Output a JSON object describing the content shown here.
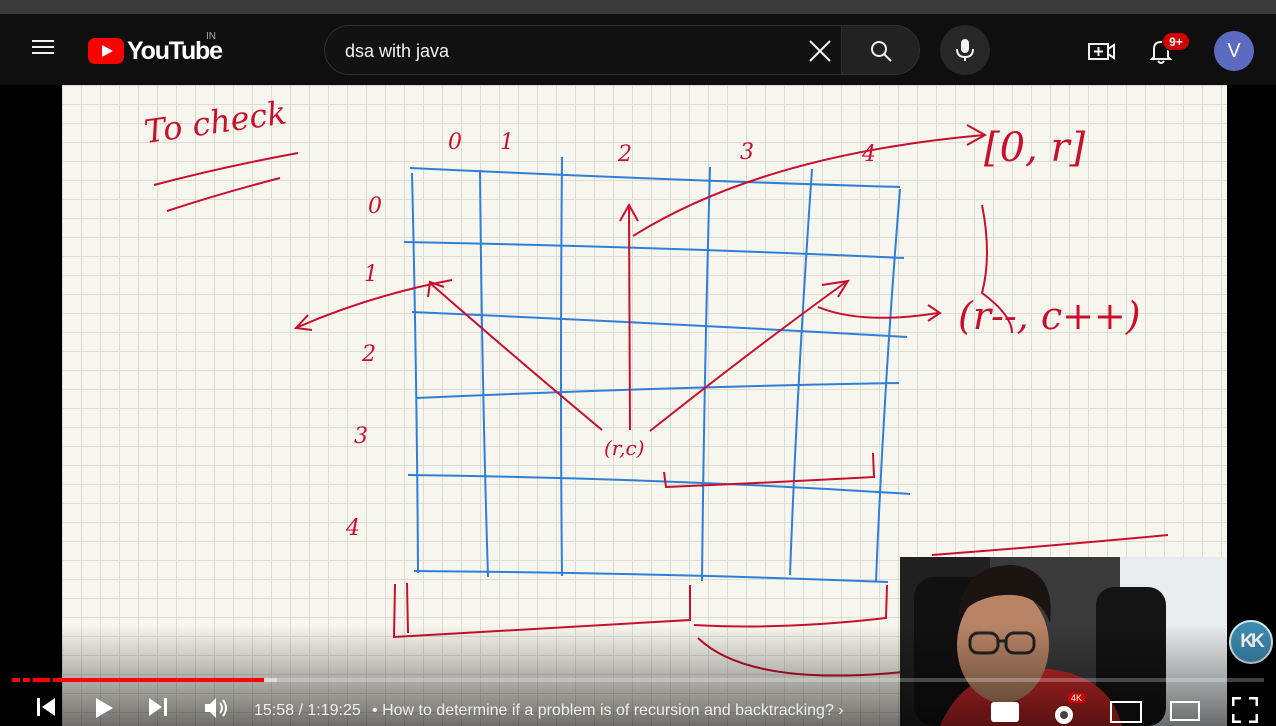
{
  "masthead": {
    "logo_text": "YouTube",
    "country_code": "IN",
    "search_value": "dsa with java",
    "notification_count": "9+",
    "avatar_letter": "V",
    "icons": [
      "menu-icon",
      "youtube-logo",
      "clear-icon",
      "search-icon",
      "mic-icon",
      "create-icon",
      "bell-icon"
    ]
  },
  "whiteboard": {
    "heading": "To check",
    "column_labels": [
      "0",
      "1",
      "2",
      "3",
      "4"
    ],
    "row_labels": [
      "0",
      "1",
      "2",
      "3",
      "4"
    ],
    "cell_label": "(r,c)",
    "range_label": "[0, r]",
    "diagonal_label": "(r--, c++)"
  },
  "overlay": {
    "channel_badge": "KK"
  },
  "player": {
    "time": "15:58 / 1:19:25",
    "chapter_separator": "•",
    "chapter_title": "How to determine if a problem is of recursion and backtracking?",
    "progress_played_fraction": 0.201,
    "progress_loaded_fraction": 0.212,
    "accent_color": "#ff0000",
    "quality_badge": "4K"
  }
}
